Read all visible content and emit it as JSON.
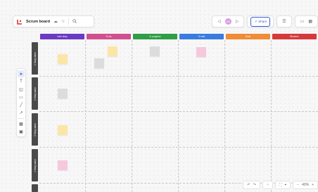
{
  "header": {
    "title": "Scrum board",
    "logo_color": "#e03131",
    "icons": [
      "cloud-icon",
      "star-icon",
      "search-icon"
    ]
  },
  "top_right": {
    "avatar_initials": "AB",
    "share_label": "Share",
    "icons": [
      "present-icon",
      "image-icon",
      "grid-icon"
    ]
  },
  "tools": [
    "select-icon",
    "text-icon",
    "shape-icon",
    "comment-icon",
    "pen-icon",
    "connector-icon",
    "table-icon",
    "frame-icon"
  ],
  "columns": [
    {
      "label": "User story",
      "color": "#6b3ac2"
    },
    {
      "label": "To do",
      "color": "#d14f8e"
    },
    {
      "label": "In progress",
      "color": "#2f9e44"
    },
    {
      "label": "To test",
      "color": "#3a7be0"
    },
    {
      "label": "Done",
      "color": "#f08c35"
    },
    {
      "label": "Blockers",
      "color": "#d63939"
    }
  ],
  "rows": [
    {
      "label": "1 Story name"
    },
    {
      "label": "2 Story name"
    },
    {
      "label": "3 Story name"
    },
    {
      "label": "4 Story name"
    }
  ],
  "notes": [
    {
      "row": 0,
      "col": 0,
      "color": "#fbe6a6"
    },
    {
      "row": 0,
      "col": 1,
      "color": "#fbe6a6"
    },
    {
      "row": 0,
      "col": 1,
      "color": "#dcdcdc"
    },
    {
      "row": 0,
      "col": 2,
      "color": "#dcdcdc"
    },
    {
      "row": 0,
      "col": 3,
      "color": "#f6c8dc"
    },
    {
      "row": 1,
      "col": 0,
      "color": "#dcdcdc"
    },
    {
      "row": 2,
      "col": 0,
      "color": "#fbe6a6"
    },
    {
      "row": 3,
      "col": 0,
      "color": "#f6c8dc"
    }
  ],
  "footer": {
    "zoom": "40%",
    "icons": [
      "undo-icon",
      "redo-icon",
      "history-icon",
      "fit-icon",
      "locate-icon",
      "zoom-out-icon",
      "zoom-in-icon"
    ]
  }
}
